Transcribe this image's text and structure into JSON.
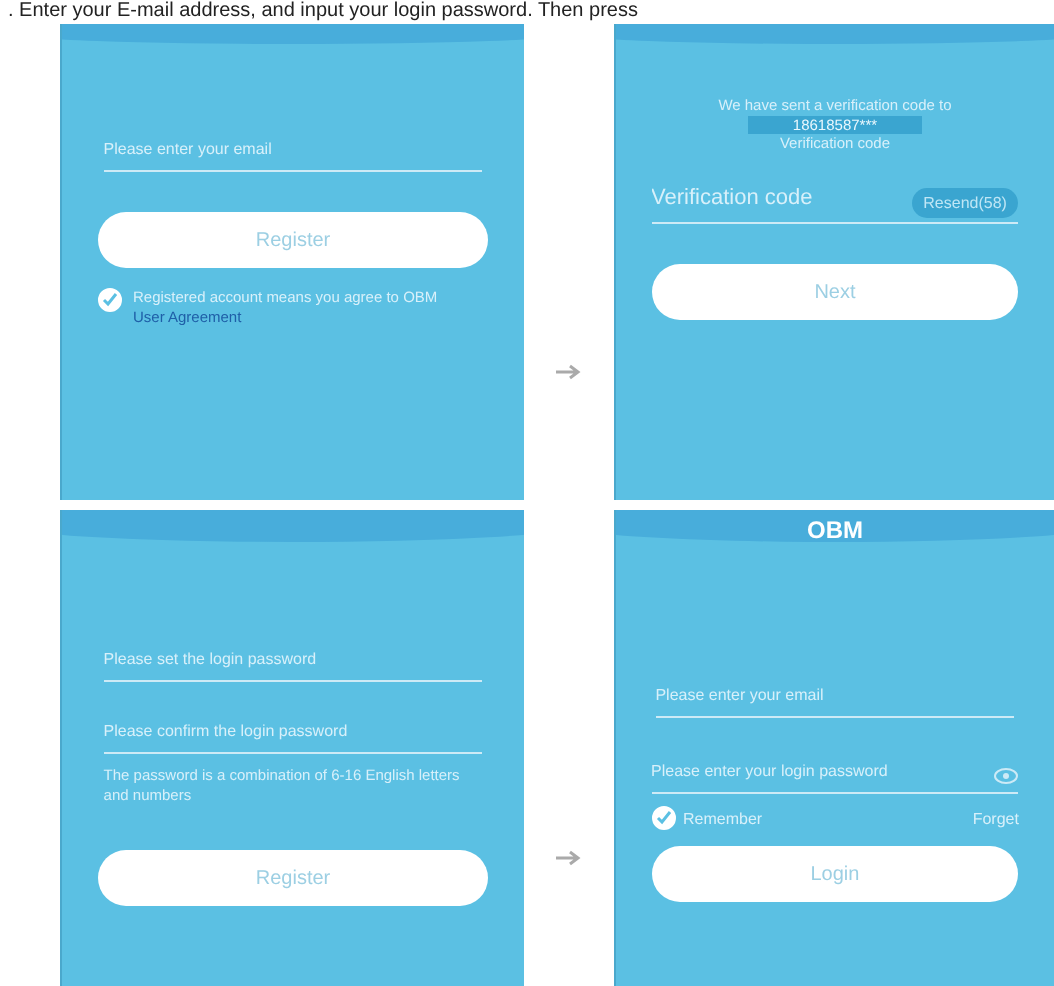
{
  "caption": ". Enter your E-mail address, and input your login password. Then press",
  "screens": [
    {
      "kind": "register_email",
      "email": {
        "placeholder": "Please enter your email"
      },
      "button": "Register",
      "agree": {
        "checked": true,
        "text": "Registered account means you agree to OBM",
        "link": "User Agreement"
      }
    },
    {
      "kind": "verify",
      "message": "We have sent a verification code to",
      "phone": "18618587***",
      "message_end": "Verification code",
      "code": {
        "placeholder": "Verification code"
      },
      "resend": "Resend(58)",
      "button": "Next"
    },
    {
      "kind": "set_password",
      "password": {
        "placeholder": "Please set the login password"
      },
      "confirm": {
        "placeholder": "Please confirm the login password"
      },
      "hint": "The password is a combination of 6-16 English letters and numbers",
      "button": "Register"
    },
    {
      "kind": "login",
      "title": "OBM",
      "email": {
        "placeholder": "Please enter your email"
      },
      "password": {
        "placeholder": "Please enter your login password"
      },
      "remember": {
        "checked": true,
        "label": "Remember"
      },
      "forget": "Forget",
      "button": "Login"
    }
  ]
}
